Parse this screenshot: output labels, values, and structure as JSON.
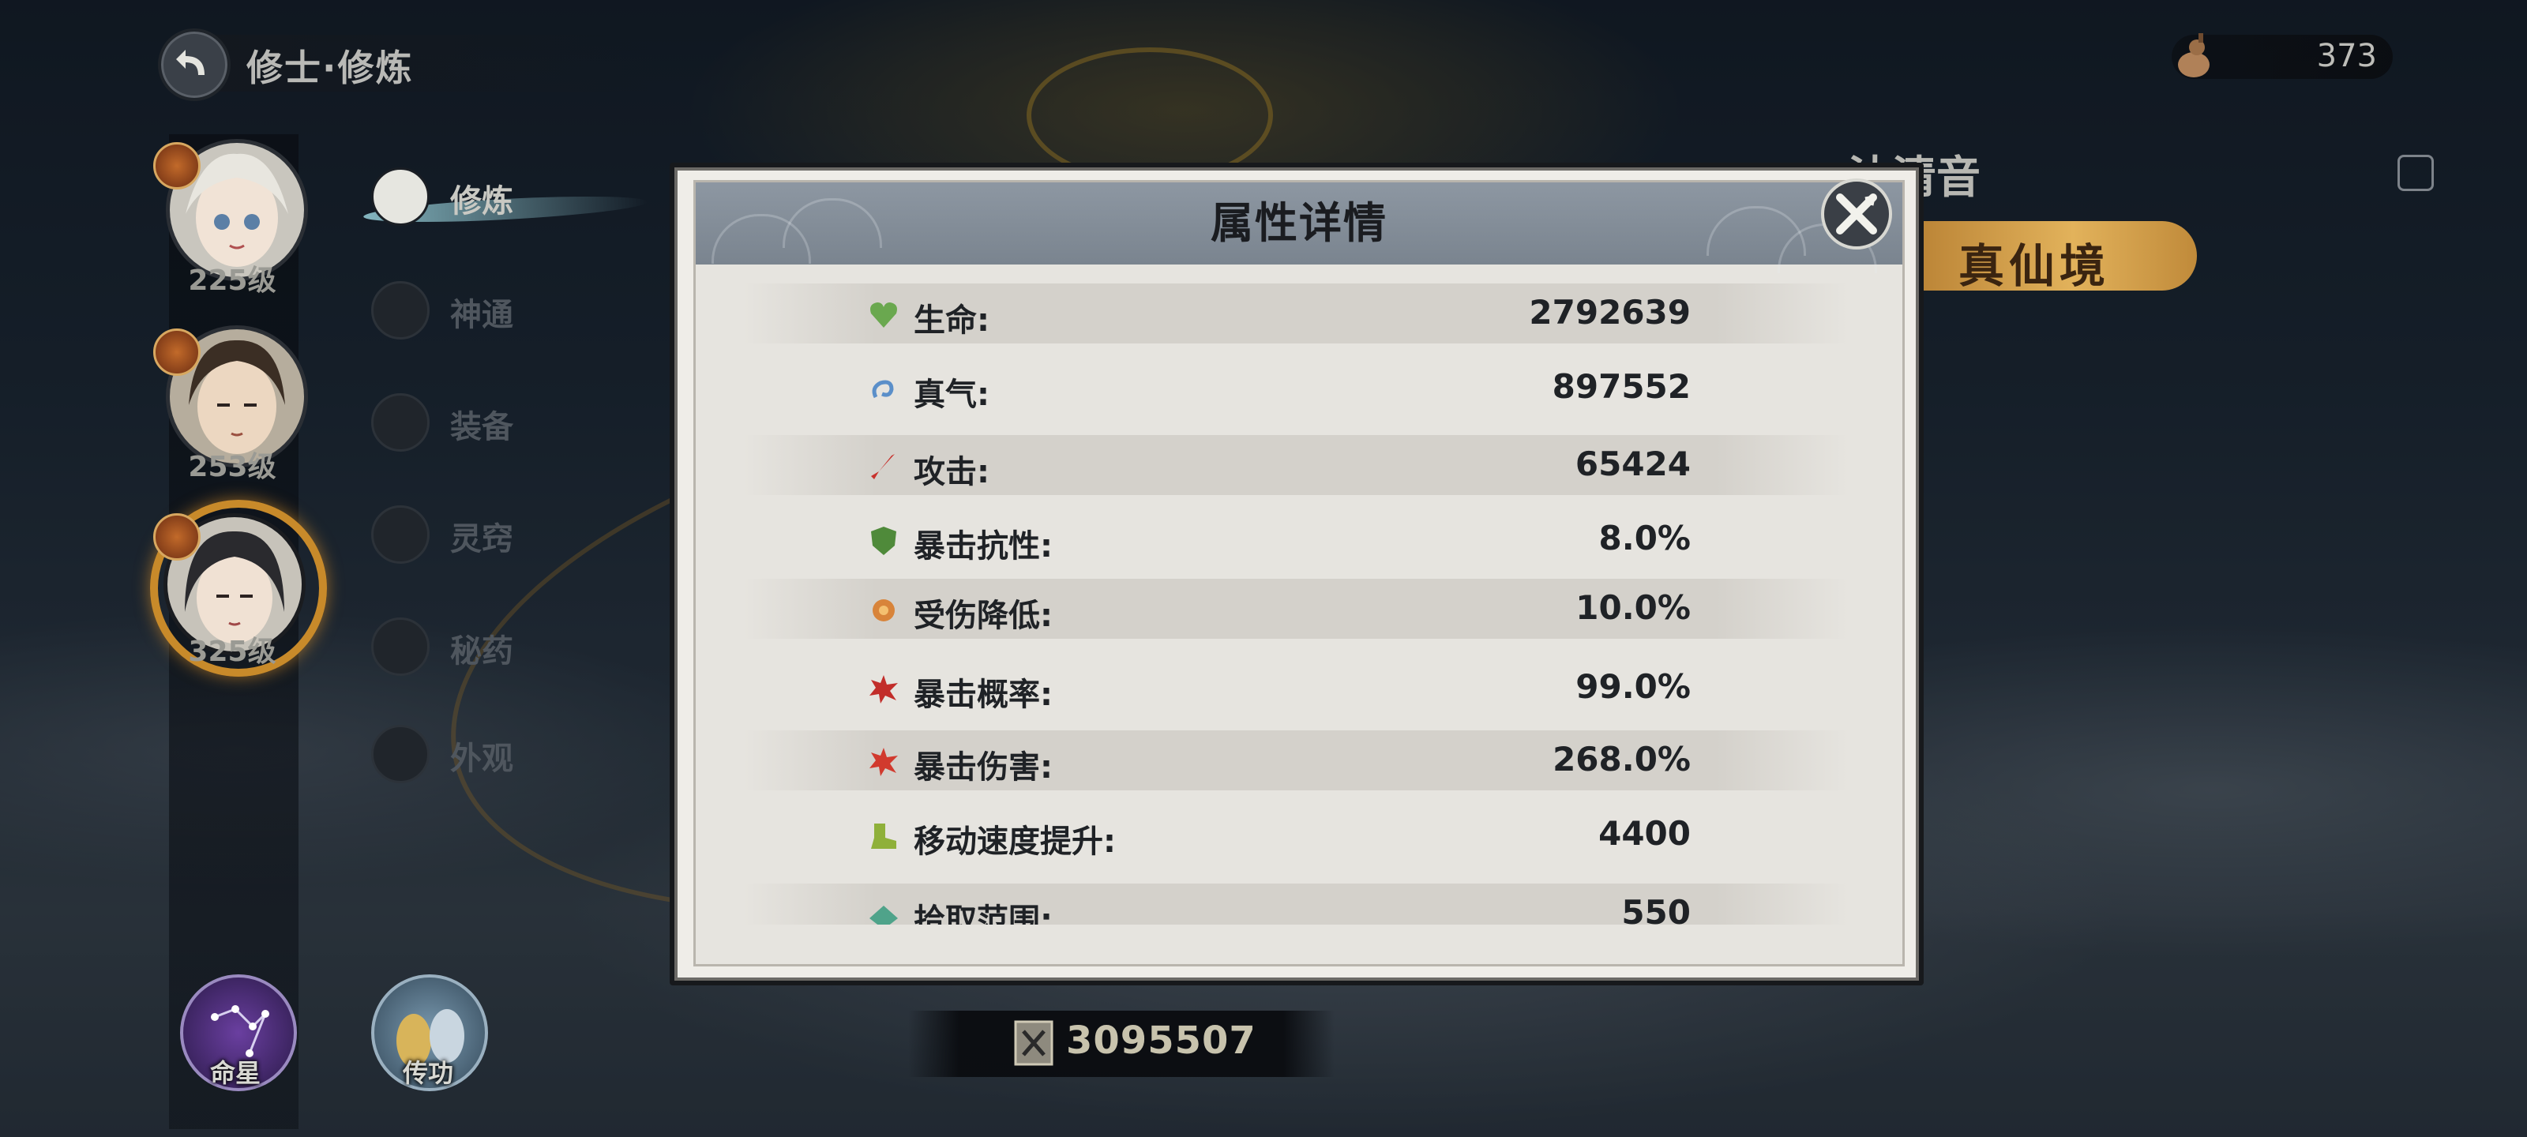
{
  "header": {
    "title": "修士·修炼",
    "currency": {
      "icon": "gourd-icon",
      "value": "373"
    }
  },
  "characters": [
    {
      "level": "225级",
      "badge": "clock-icon",
      "hair": "#d8d6cf"
    },
    {
      "level": "253级",
      "badge": "yin-yang-icon",
      "hair": "#3b2e24"
    },
    {
      "level": "325级",
      "badge": "yin-yang-icon",
      "hair": "#2a2a2e",
      "active": true
    }
  ],
  "menu": [
    {
      "label": "修炼",
      "icon": "yin-yang-icon",
      "active": true
    },
    {
      "label": "神通",
      "icon": "sword-icon"
    },
    {
      "label": "装备",
      "icon": "equipment-icon"
    },
    {
      "label": "灵窍",
      "icon": "spirit-icon"
    },
    {
      "label": "秘药",
      "icon": "potion-icon"
    },
    {
      "label": "外观",
      "icon": "appearance-icon"
    }
  ],
  "character_panel": {
    "name": "沈清音",
    "realm": "真仙境"
  },
  "bottom": {
    "star_label": "命星",
    "transfer_label": "传功",
    "power_value": "3095507"
  },
  "modal": {
    "title": "属性详情",
    "rows": [
      {
        "label": "生命:",
        "value": "2792639",
        "icon": "heart-icon",
        "color": "#6aa84f"
      },
      {
        "label": "真气:",
        "value": "897552",
        "icon": "qi-swirl-icon",
        "color": "#5b8fc9"
      },
      {
        "label": "攻击:",
        "value": "65424",
        "icon": "blade-icon",
        "color": "#c8322d"
      },
      {
        "label": "暴击抗性:",
        "value": "8.0%",
        "icon": "shield-icon",
        "color": "#4f8a3a"
      },
      {
        "label": "受伤降低:",
        "value": "10.0%",
        "icon": "flower-icon",
        "color": "#d8843a"
      },
      {
        "label": "暴击概率:",
        "value": "99.0%",
        "icon": "crit-rate-icon",
        "color": "#c22d2a"
      },
      {
        "label": "暴击伤害:",
        "value": "268.0%",
        "icon": "crit-damage-icon",
        "color": "#c22d2a"
      },
      {
        "label": "移动速度提升:",
        "value": "4400",
        "icon": "boot-icon",
        "color": "#8fb03a"
      },
      {
        "label": "拾取范围:",
        "value": "550",
        "icon": "pickup-icon",
        "color": "#4fa38a"
      }
    ]
  }
}
